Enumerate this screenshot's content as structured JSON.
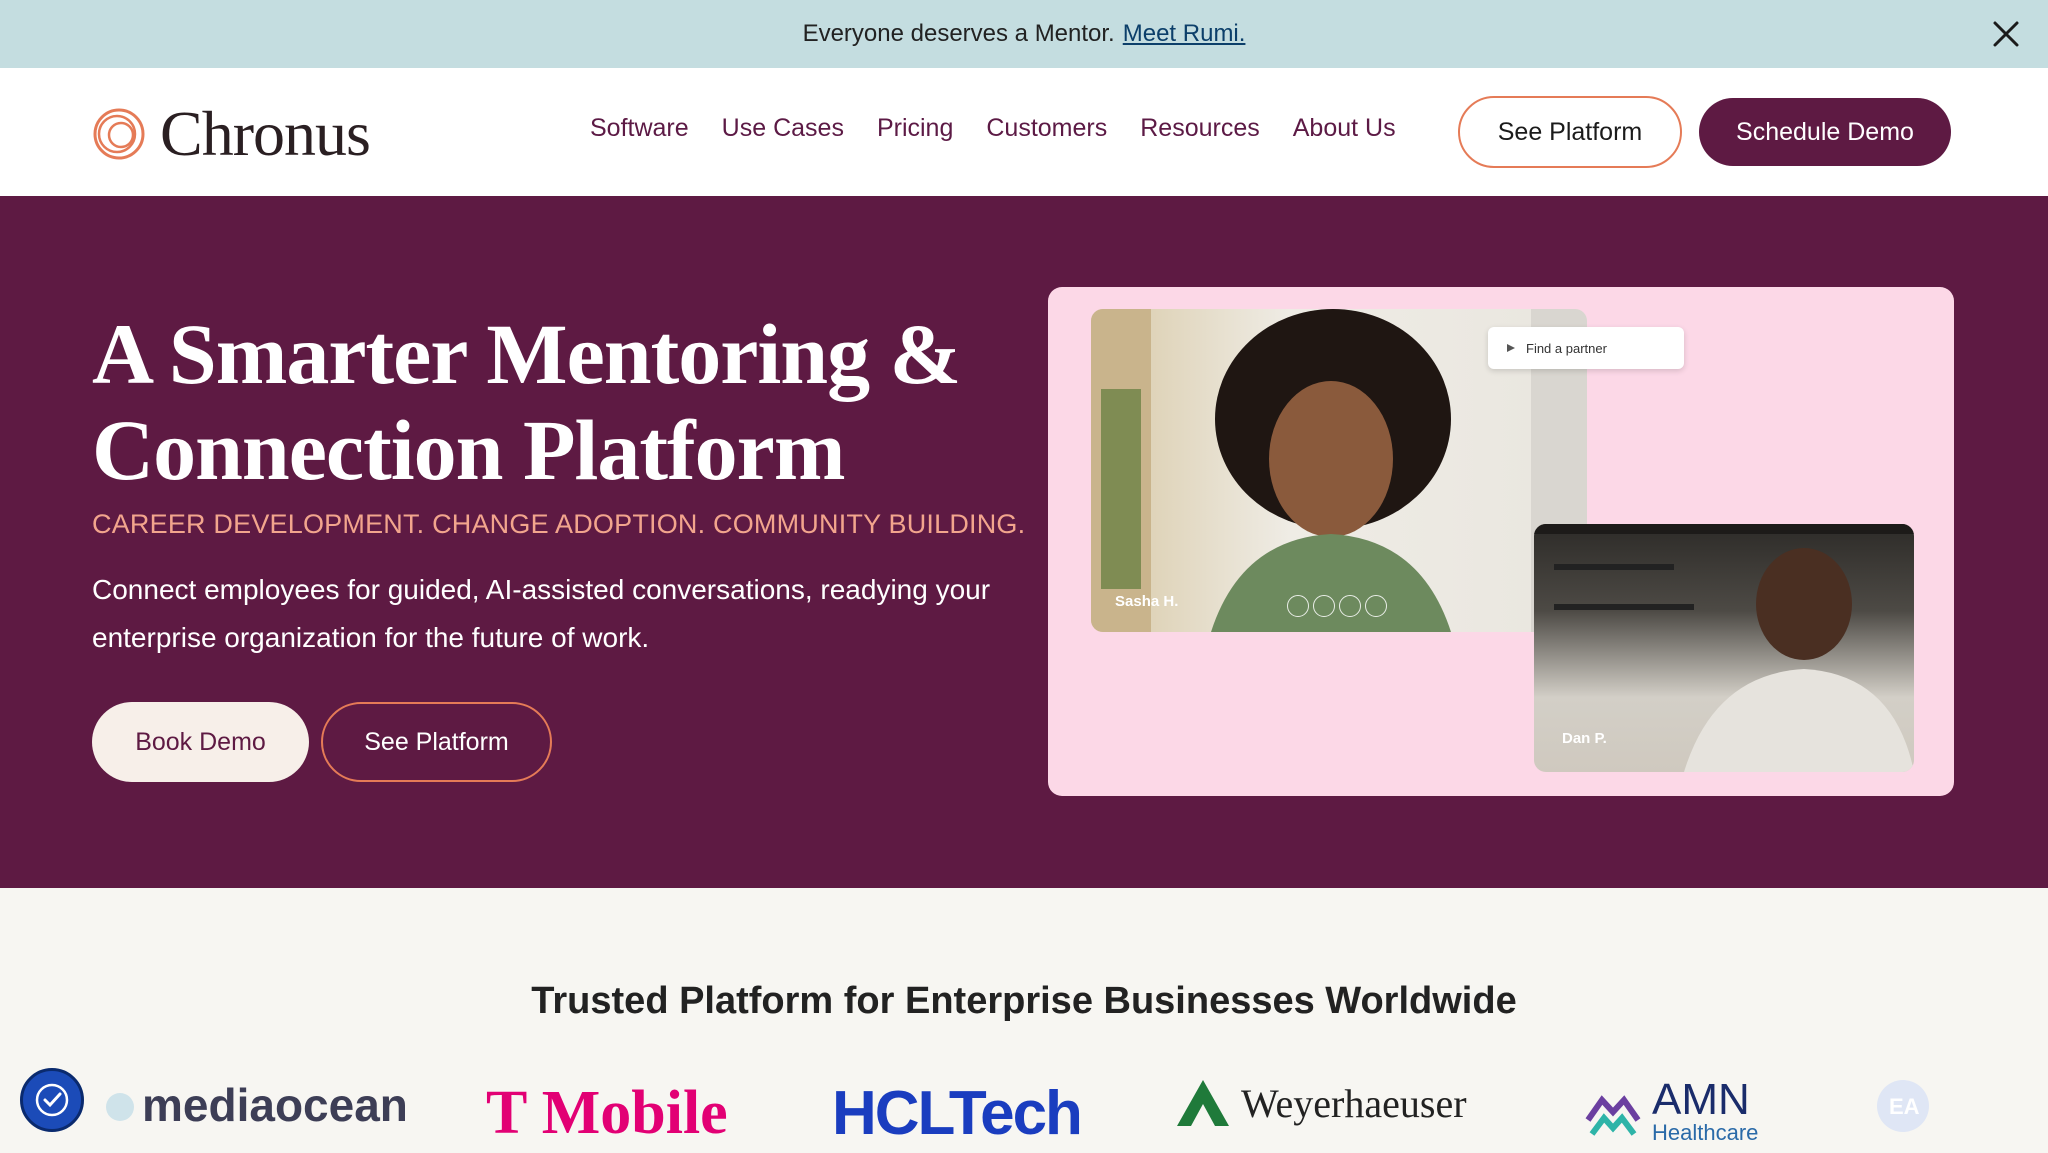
{
  "announcement": {
    "text": "Everyone deserves a Mentor.",
    "link": "Meet Rumi."
  },
  "header": {
    "logo_text": "Chronus",
    "nav": [
      "Software",
      "Use Cases",
      "Pricing",
      "Customers",
      "Resources",
      "About Us"
    ],
    "see_platform": "See Platform",
    "schedule_demo": "Schedule Demo"
  },
  "hero": {
    "title_line1": "A Smarter Mentoring &",
    "title_line2": "Connection Platform",
    "tagline": "CAREER DEVELOPMENT. CHANGE ADOPTION. COMMUNITY BUILDING.",
    "description": "Connect employees for guided, AI-assisted conversations, readying your enterprise organization for the future of work.",
    "book_demo": "Book Demo",
    "see_platform": "See Platform",
    "visual": {
      "find_partner": "Find a partner",
      "person1": "Sasha H.",
      "person2": "Dan P."
    }
  },
  "trusted": {
    "title": "Trusted Platform for Enterprise Businesses Worldwide",
    "logos": [
      "mediaocean",
      "T Mobile",
      "HCLTech",
      "Weyerhaeuser",
      "AMN",
      "Healthcare"
    ]
  },
  "colors": {
    "brand_plum": "#5e1a43",
    "accent_orange": "#e57b57",
    "announce_bg": "#c4dde0",
    "card_pink": "#fcd8e7"
  }
}
